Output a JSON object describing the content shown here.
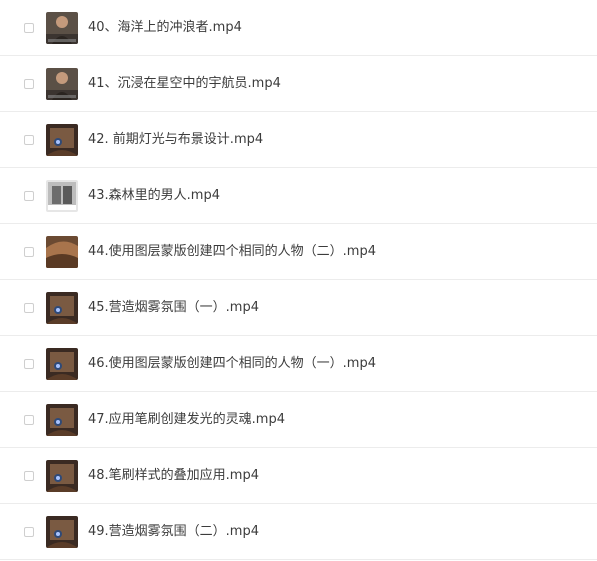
{
  "files": [
    {
      "name": "40、海洋上的冲浪者.mp4",
      "thumbnail": "person-portrait-thumbnail"
    },
    {
      "name": "41、沉浸在星空中的宇航员.mp4",
      "thumbnail": "person-portrait-thumbnail"
    },
    {
      "name": "42. 前期灯光与布景设计.mp4",
      "thumbnail": "dark-scene-thumbnail"
    },
    {
      "name": "43.森林里的男人.mp4",
      "thumbnail": "gray-forest-thumbnail"
    },
    {
      "name": "44.使用图层蒙版创建四个相同的人物（二）.mp4",
      "thumbnail": "warm-scene-thumbnail"
    },
    {
      "name": "45.营造烟雾氛围（一）.mp4",
      "thumbnail": "dark-scene-thumbnail"
    },
    {
      "name": "46.使用图层蒙版创建四个相同的人物（一）.mp4",
      "thumbnail": "dark-scene-thumbnail"
    },
    {
      "name": "47.应用笔刷创建发光的灵魂.mp4",
      "thumbnail": "dark-scene-thumbnail"
    },
    {
      "name": "48.笔刷样式的叠加应用.mp4",
      "thumbnail": "dark-scene-thumbnail"
    },
    {
      "name": "49.营造烟雾氛围（二）.mp4",
      "thumbnail": "dark-scene-thumbnail"
    }
  ]
}
